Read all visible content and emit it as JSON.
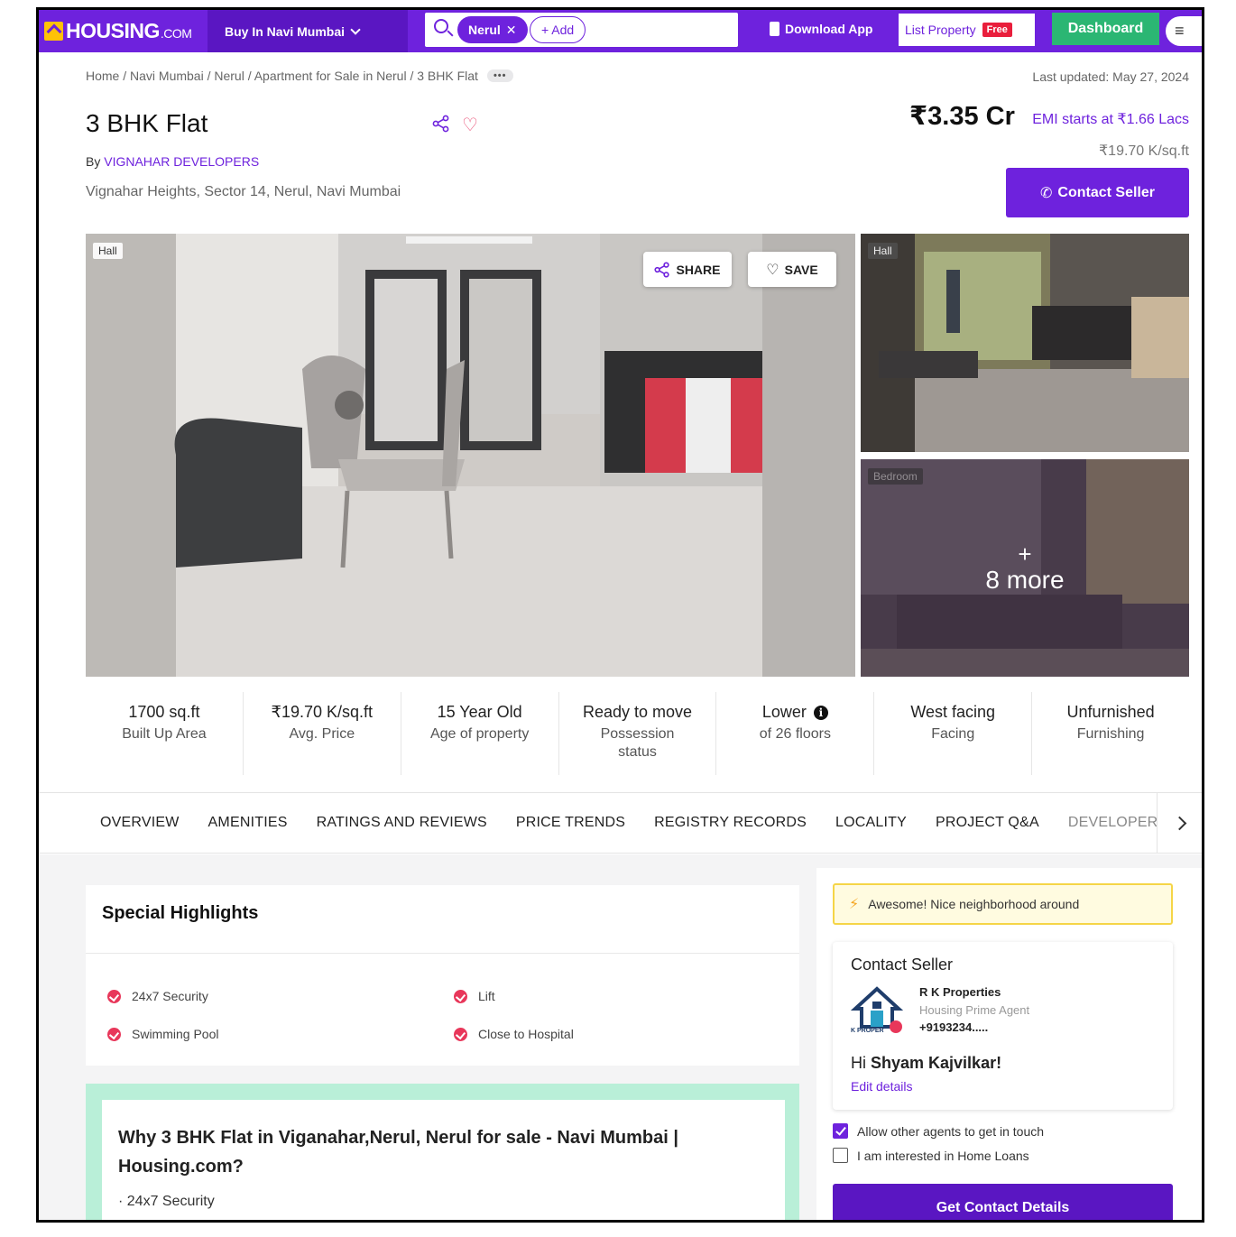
{
  "nav": {
    "logo_main": "HOUSING",
    "logo_suffix": ".COM",
    "city_label": "Buy In Navi Mumbai",
    "search_chip": "Nerul",
    "search_add": "+ Add",
    "download_app": "Download App",
    "list_property": "List Property",
    "free_badge": "Free",
    "dashboard": "Dashboard"
  },
  "breadcrumb": {
    "text": "Home / Navi Mumbai / Nerul / Apartment for Sale in Nerul / 3 BHK Flat",
    "more": "•••"
  },
  "last_updated": "Last updated: May 27, 2024",
  "listing": {
    "title": "3 BHK Flat",
    "by_prefix": "By ",
    "developer": "VIGNAHAR DEVELOPERS",
    "address": "Vignahar Heights, Sector 14, Nerul, Navi Mumbai",
    "price": "₹3.35 Cr",
    "emi": "EMI starts at ₹1.66 Lacs",
    "price_per_sqft": "₹19.70 K/sq.ft",
    "contact_seller": "Contact Seller"
  },
  "gallery": {
    "main_tag": "Hall",
    "share": "SHARE",
    "save": "SAVE",
    "side1_tag": "Hall",
    "side2_tag": "Bedroom",
    "more_plus": "+",
    "more_text": "8 more"
  },
  "stats": [
    {
      "value": "1700 sq.ft",
      "label": "Built Up Area"
    },
    {
      "value": "₹19.70 K/sq.ft",
      "label": "Avg. Price"
    },
    {
      "value": "15 Year Old",
      "label": "Age of property"
    },
    {
      "value": "Ready to move",
      "label": "Possession status"
    },
    {
      "value": "Lower",
      "label": "of 26 floors"
    },
    {
      "value": "West facing",
      "label": "Facing"
    },
    {
      "value": "Unfurnished",
      "label": "Furnishing"
    }
  ],
  "tabs": [
    "OVERVIEW",
    "AMENITIES",
    "RATINGS AND REVIEWS",
    "PRICE TRENDS",
    "REGISTRY RECORDS",
    "LOCALITY",
    "PROJECT Q&A",
    "DEVELOPER"
  ],
  "highlights": {
    "title": "Special Highlights",
    "items": [
      "24x7 Security",
      "Lift",
      "Swimming Pool",
      "Close to Hospital"
    ]
  },
  "why": {
    "title": "Why 3 BHK Flat in Viganahar,Nerul, Nerul for sale - Navi Mumbai | Housing.com?",
    "item": "· 24x7 Security"
  },
  "sidebar": {
    "neighborhood": "Awesome! Nice neighborhood around",
    "contact_title": "Contact Seller",
    "agent_name": "R K Properties",
    "agent_role": "Housing Prime Agent",
    "agent_phone": "+9193234.....",
    "logo_text": "K PROPER",
    "greeting_prefix": "Hi ",
    "greeting_name": "Shyam Kajvilkar!",
    "edit_details": "Edit details",
    "allow_agents": "Allow other agents to get in touch",
    "home_loans": "I am interested in Home Loans",
    "get_contact": "Get Contact Details"
  },
  "colors": {
    "brand_purple": "#6e22dd",
    "dashboard_green": "#2bb673",
    "free_red": "#e91e3c"
  }
}
